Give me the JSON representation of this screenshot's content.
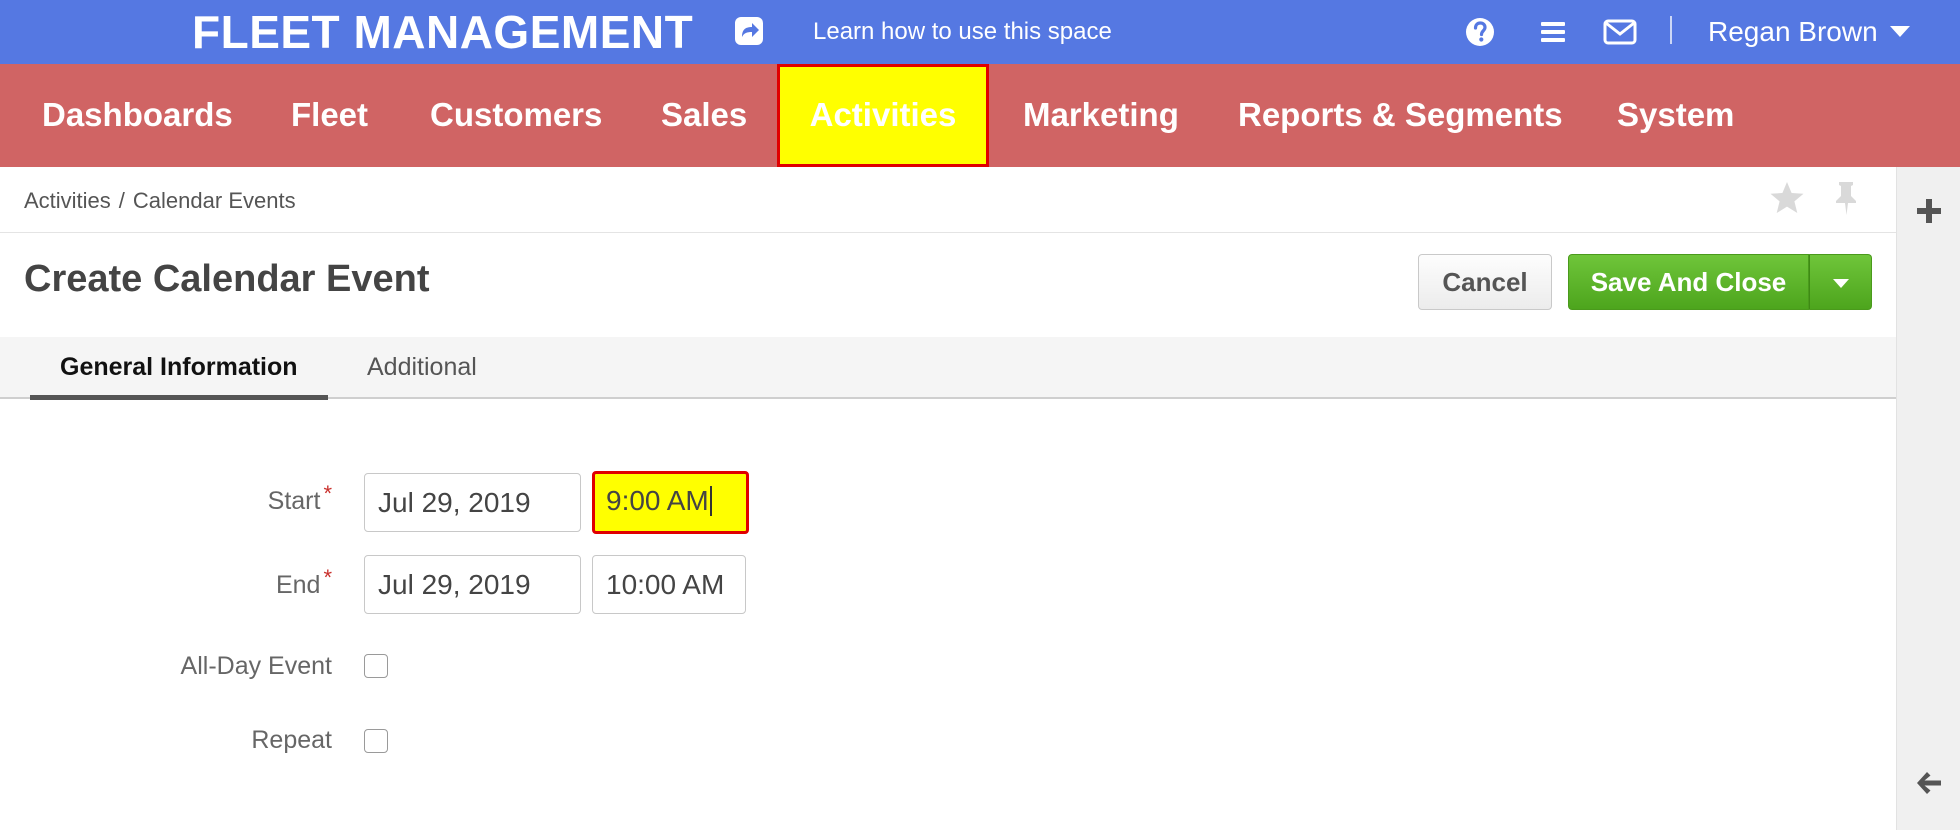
{
  "topbar": {
    "brand": "FLEET MANAGEMENT",
    "learn_link": "Learn how to use this space",
    "user_name": "Regan Brown",
    "icons": [
      "share-icon",
      "help-icon",
      "menu-icon",
      "mail-icon",
      "chevron-down-icon"
    ],
    "background_color": "#5578e2"
  },
  "main_nav": {
    "background_color": "#d06464",
    "items": [
      {
        "label": "Dashboards",
        "active": false
      },
      {
        "label": "Fleet",
        "active": false
      },
      {
        "label": "Customers",
        "active": false
      },
      {
        "label": "Sales",
        "active": false
      },
      {
        "label": "Activities",
        "active": true
      },
      {
        "label": "Marketing",
        "active": false
      },
      {
        "label": "Reports & Segments",
        "active": false
      },
      {
        "label": "System",
        "active": false
      }
    ]
  },
  "breadcrumb": {
    "parent": "Activities",
    "separator": "/",
    "current": "Calendar Events"
  },
  "page": {
    "title": "Create Calendar Event",
    "cancel_label": "Cancel",
    "save_label": "Save And Close"
  },
  "tabs": [
    {
      "label": "General Information",
      "active": true
    },
    {
      "label": "Additional",
      "active": false
    }
  ],
  "form": {
    "start": {
      "label": "Start",
      "required_mark": "*",
      "date": "Jul 29, 2019",
      "time": "9:00 AM"
    },
    "end": {
      "label": "End",
      "required_mark": "*",
      "date": "Jul 29, 2019",
      "time": "10:00 AM"
    },
    "all_day": {
      "label": "All-Day Event",
      "checked": false
    },
    "repeat": {
      "label": "Repeat",
      "checked": false
    }
  },
  "highlight_color": "#ffff00",
  "highlight_border_color": "#e00000",
  "save_button_color": "#5cb52a"
}
